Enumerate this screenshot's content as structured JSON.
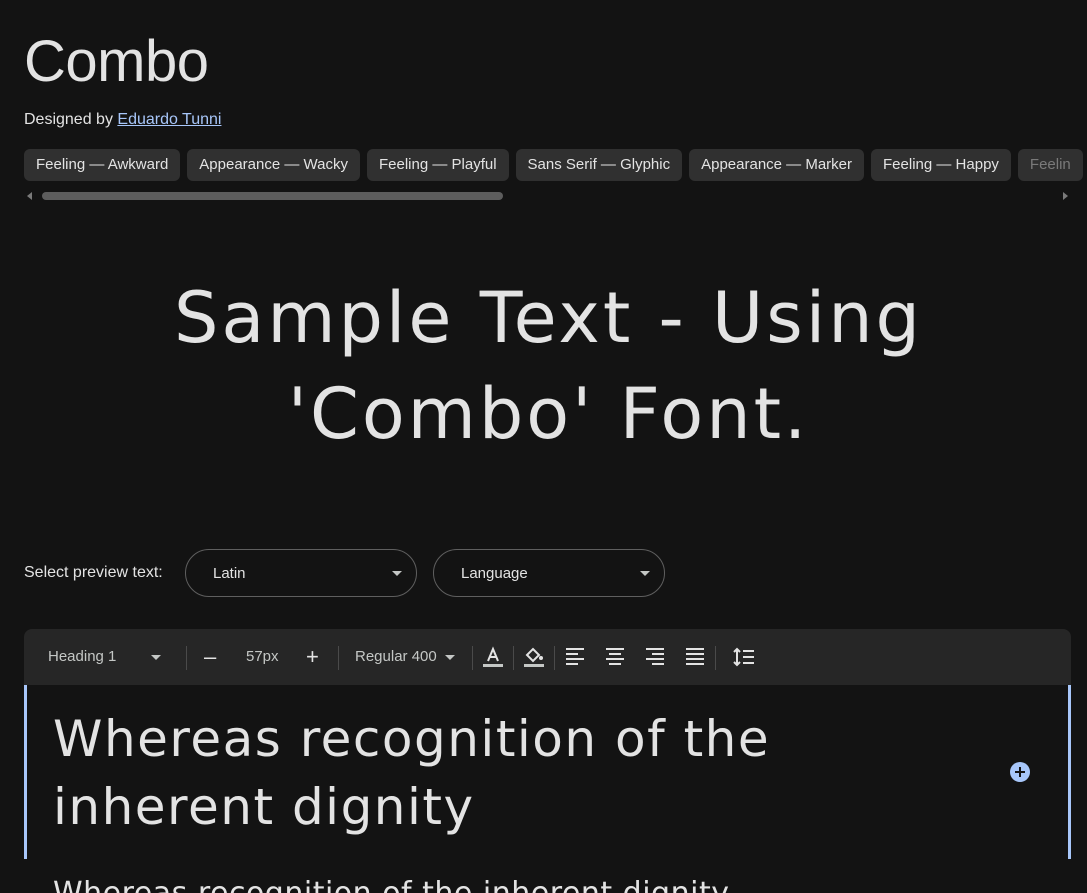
{
  "font": {
    "name": "Combo",
    "designed_by_prefix": "Designed by",
    "designer": "Eduardo Tunni"
  },
  "tags": [
    "Feeling — Awkward",
    "Appearance — Wacky",
    "Feeling — Playful",
    "Sans Serif — Glyphic",
    "Appearance — Marker",
    "Feeling — Happy",
    "Feelin"
  ],
  "sample": {
    "text": "Sample Text - Using 'Combo' Font."
  },
  "preview": {
    "label": "Select preview text:",
    "script_value": "Latin",
    "language_value": "Language"
  },
  "toolbar": {
    "style_value": "Heading 1",
    "size_value": "57px",
    "decrease_symbol": "–",
    "increase_symbol": "+",
    "weight_value": "Regular 400"
  },
  "editor": {
    "heading_text": "Whereas recognition of the inherent dignity",
    "next_line_text": "Whereas recognition of the inherent dignity"
  },
  "colors": {
    "background": "#131313",
    "accent": "#a8c7fa",
    "tag_bg": "#303030",
    "toolbar_bg": "#262626"
  }
}
